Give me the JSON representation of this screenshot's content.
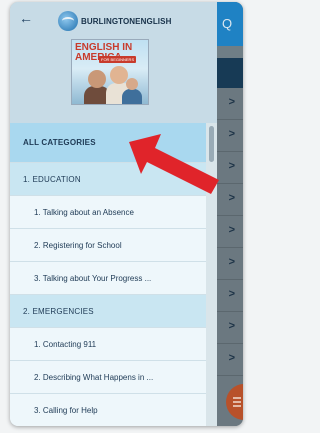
{
  "header": {
    "back_icon": "arrow-left-icon",
    "brand": "BURLINGTONENGLISH",
    "course_title": "ENGLISH IN AMERICA",
    "course_badge": "FOR BEGINNERS"
  },
  "menu": {
    "all_categories": "ALL CATEGORIES",
    "items": [
      {
        "type": "category",
        "label": "1. EDUCATION"
      },
      {
        "type": "lesson",
        "label": "1. Talking about an Absence"
      },
      {
        "type": "lesson",
        "label": "2. Registering for School"
      },
      {
        "type": "lesson",
        "label": "3. Talking about Your Progress ..."
      },
      {
        "type": "category",
        "label": "2. EMERGENCIES"
      },
      {
        "type": "lesson",
        "label": "1. Contacting 911"
      },
      {
        "type": "lesson",
        "label": "2. Describing What Happens in ..."
      },
      {
        "type": "lesson",
        "label": "3. Calling for Help"
      }
    ]
  },
  "background": {
    "chevron": ">",
    "search_icon": "search-icon"
  },
  "annotation": {
    "color": "#e0242a"
  }
}
